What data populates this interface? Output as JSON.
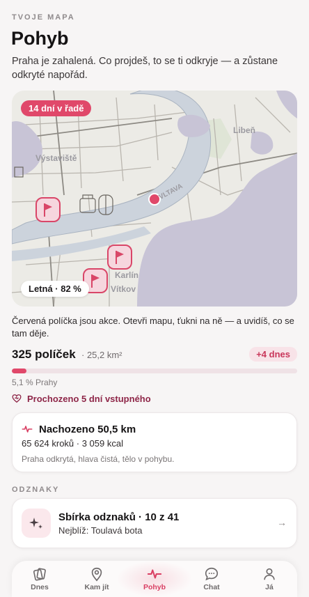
{
  "header": {
    "eyebrow": "TVOJE MAPA",
    "title": "Pohyb",
    "subtitle": "Praha je zahalená. Co projdeš, to se ti odkryje — a zůstane odkryté napořád."
  },
  "map": {
    "streak_pill": "14 dní v řadě",
    "area_pill": "Letná · 82 %",
    "labels": {
      "liben": "Libeň",
      "vystaviste": "Výstaviště",
      "vltava": "VLTAVA",
      "karlin": "Karlín",
      "vitkov": "Vítkov"
    },
    "colors": {
      "fog": "#c8c4d6",
      "river": "#ccd3dc",
      "flag": "#d94668",
      "location": "#e0486a"
    }
  },
  "hint": "Červená políčka jsou akce. Otevři mapu, ťukni na ně — a uvidíš, co se tam děje.",
  "stats": {
    "cells": "325 políček",
    "area": "· 25,2 km²",
    "today_badge": "+4 dnes",
    "progress_label": "5,1 % Prahy",
    "progress_percent": 5.1
  },
  "streak": {
    "text": "Prochozeno 5 dní vstupného",
    "icon": "heart-icon"
  },
  "walk": {
    "title": "Nachozeno 50,5 km",
    "subtitle": "65 624 kroků · 3 059 kcal",
    "note": "Praha odkrytá, hlava čistá, tělo v pohybu.",
    "icon": "pulse-icon"
  },
  "badges_section": {
    "label": "ODZNAKY",
    "title": "Sbírka odznaků · 10 z 41",
    "subtitle": "Nejblíž: Toulavá bota",
    "icon": "sparkle-icon"
  },
  "nav": {
    "items": [
      {
        "label": "Dnes",
        "icon": "cards-icon"
      },
      {
        "label": "Kam jít",
        "icon": "map-pin-icon"
      },
      {
        "label": "Pohyb",
        "icon": "pulse-icon"
      },
      {
        "label": "Chat",
        "icon": "chat-bubble-icon"
      },
      {
        "label": "Já",
        "icon": "person-icon"
      }
    ],
    "active": "Pohyb"
  }
}
